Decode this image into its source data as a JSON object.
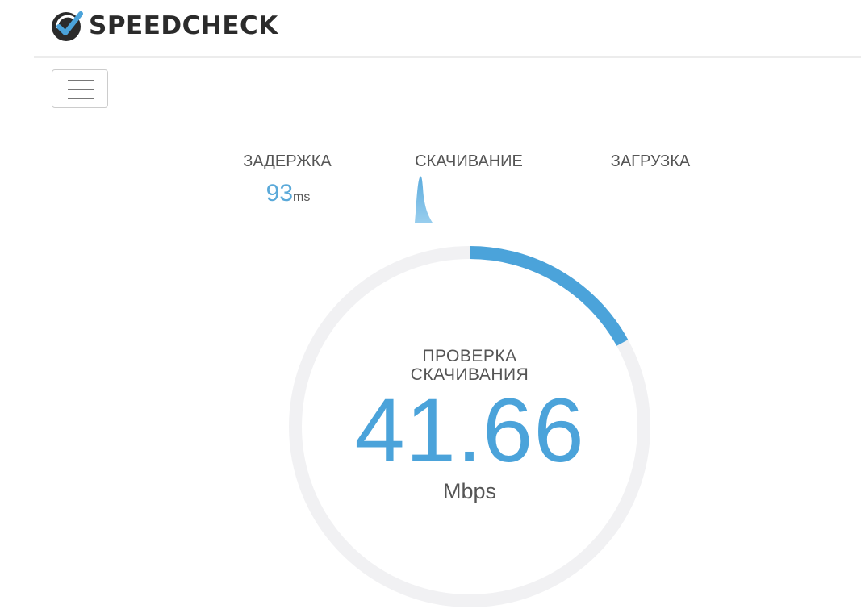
{
  "header": {
    "brand_name": "SPEEDCHECK",
    "logo_icon": "checkmark-badge-icon",
    "menu_icon": "hamburger-menu-icon"
  },
  "metrics": {
    "latency": {
      "label": "ЗАДЕРЖКА",
      "value": "93",
      "unit": "ms"
    },
    "download": {
      "label": "СКАЧИВАНИЕ"
    },
    "upload": {
      "label": "ЗАГРУЗКА"
    }
  },
  "gauge": {
    "title_line1": "ПРОВЕРКА",
    "title_line2": "СКАЧИВАНИЯ",
    "value": "41.66",
    "unit": "Mbps",
    "progress_fraction": 0.17
  },
  "colors": {
    "accent": "#4ba3da",
    "track": "#f1f1f3",
    "brand_dark": "#2b2b2b",
    "text": "#555555"
  }
}
